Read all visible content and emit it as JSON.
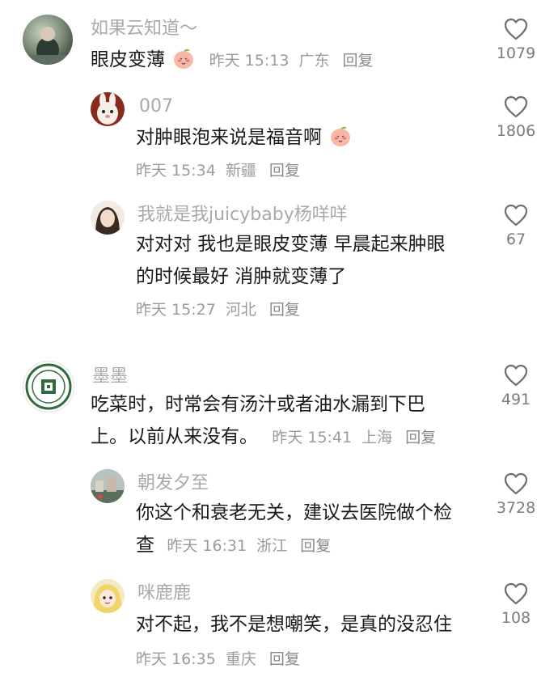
{
  "comments": [
    {
      "username": "如果云知道～",
      "line1": "眼皮变薄",
      "line2": "",
      "time": "昨天 15:13",
      "location": "广东",
      "reply_label": "回复",
      "likes": "1079",
      "has_emoji": true,
      "replies": [
        {
          "username": "007",
          "line1": "对肿眼泡来说是福音啊",
          "line2": "",
          "time": "昨天 15:34",
          "location": "新疆",
          "reply_label": "回复",
          "likes": "1806",
          "has_emoji": true
        },
        {
          "username": "我就是我juicybaby杨咩咩",
          "line1": "对对对 我也是眼皮变薄 早晨起来肿眼",
          "line2": "的时候最好 消肿就变薄了",
          "time": "昨天 15:27",
          "location": "河北",
          "reply_label": "回复",
          "likes": "67",
          "has_emoji": false
        }
      ]
    },
    {
      "username": "墨墨",
      "line1": "吃菜时，时常会有汤汁或者油水漏到下巴",
      "line2": "上。以前从来没有。",
      "time": "昨天 15:41",
      "location": "上海",
      "reply_label": "回复",
      "likes": "491",
      "has_emoji": false,
      "replies": [
        {
          "username": "朝发夕至",
          "line1": "你这个和衰老无关，建议去医院做个检",
          "line2": "查",
          "time": "昨天 16:31",
          "location": "浙江",
          "reply_label": "回复",
          "likes": "3728",
          "has_emoji": false
        },
        {
          "username": "咪鹿鹿",
          "line1": "对不起，我不是想嘲笑，是真的没忍住",
          "line2": "",
          "time": "昨天 16:35",
          "location": "重庆",
          "reply_label": "回复",
          "likes": "108",
          "has_emoji": false
        }
      ]
    }
  ],
  "icons": {
    "like": "heart-outline-icon",
    "emoji": "peach-emoji-icon"
  },
  "colors": {
    "username": "#a9a9a9",
    "text": "#1a1a1a",
    "meta": "#9b9b9b",
    "heart": "#6f6f6f"
  }
}
